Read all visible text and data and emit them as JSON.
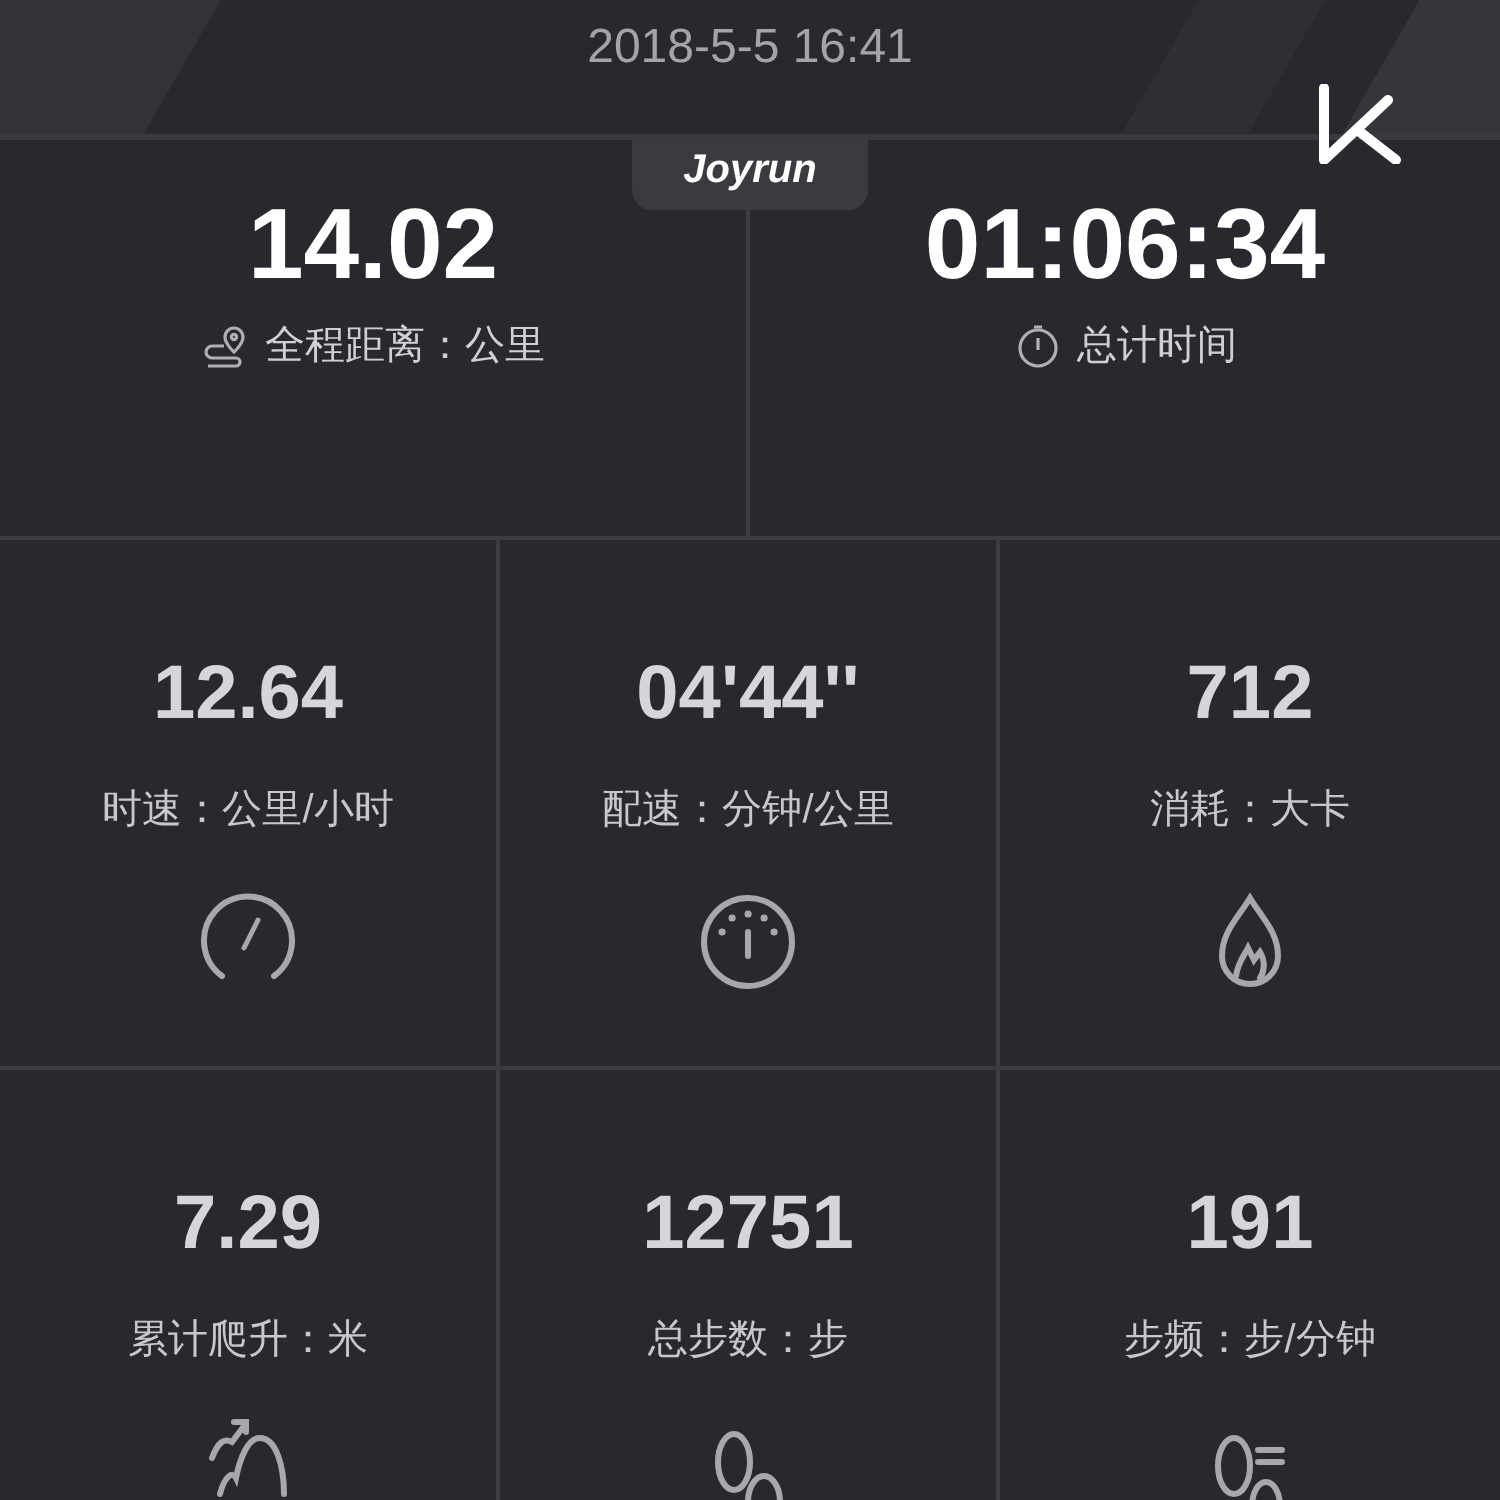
{
  "header": {
    "datetime": "2018-5-5 16:41",
    "brand_tab": "Joyrun"
  },
  "summary": [
    {
      "value": "14.02",
      "label": "全程距离：公里"
    },
    {
      "value": "01:06:34",
      "label": "总计时间"
    }
  ],
  "metrics": [
    {
      "value": "12.64",
      "label": "时速：公里/小时"
    },
    {
      "value": "04'44''",
      "label": "配速：分钟/公里"
    },
    {
      "value": "712",
      "label": "消耗：大卡"
    },
    {
      "value": "7.29",
      "label": "累计爬升：米"
    },
    {
      "value": "12751",
      "label": "总步数：步"
    },
    {
      "value": "191",
      "label": "步频：步/分钟"
    }
  ]
}
